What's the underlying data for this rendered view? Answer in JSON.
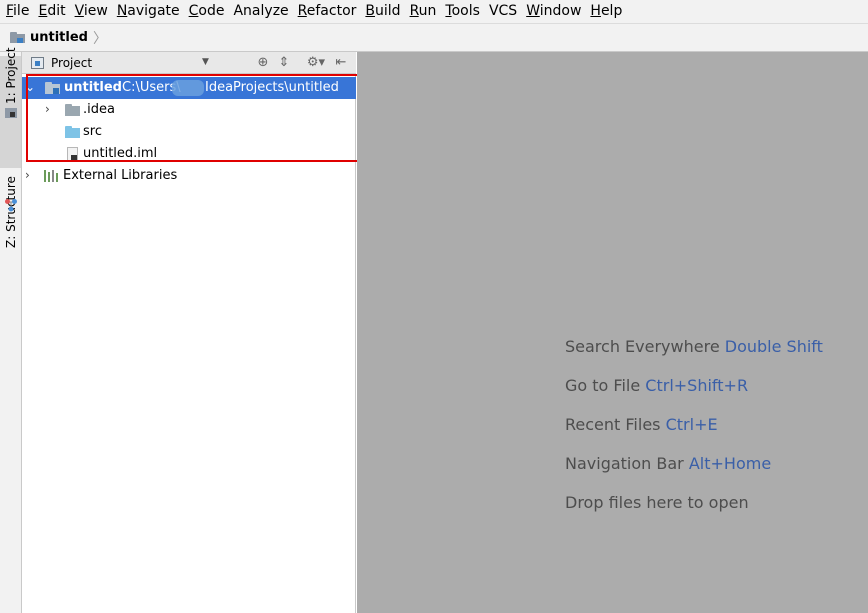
{
  "menubar": {
    "items": [
      {
        "mnemonic": "F",
        "rest": "ile"
      },
      {
        "mnemonic": "E",
        "rest": "dit"
      },
      {
        "mnemonic": "V",
        "rest": "iew"
      },
      {
        "mnemonic": "N",
        "rest": "avigate"
      },
      {
        "mnemonic": "C",
        "rest": "ode"
      },
      {
        "mnemonic": "",
        "rest": "Analyze"
      },
      {
        "mnemonic": "R",
        "rest": "efactor"
      },
      {
        "mnemonic": "B",
        "rest": "uild"
      },
      {
        "mnemonic": "R",
        "rest": "un"
      },
      {
        "mnemonic": "T",
        "rest": "ools"
      },
      {
        "mnemonic": "",
        "rest": "VCS"
      },
      {
        "mnemonic": "W",
        "rest": "indow"
      },
      {
        "mnemonic": "H",
        "rest": "elp"
      }
    ]
  },
  "breadcrumb": {
    "project": "untitled",
    "separator": "〉"
  },
  "left_strip": {
    "project_tab": "1: Project",
    "structure_tab": "Z: Structure"
  },
  "project_panel": {
    "header_title": "Project",
    "dropdown_glyph": "▼",
    "buttons": {
      "locate": "⊕",
      "collapse": "⇕",
      "settings": "⚙▾",
      "hide": "⇤"
    },
    "tree": {
      "root": {
        "name": "untitled",
        "path_prefix": "C:\\Users\\",
        "path_suffix": "IdeaProjects\\untitled",
        "chevron": "⌄"
      },
      "children": [
        {
          "name": ".idea",
          "chevron": "›"
        },
        {
          "name": "src"
        },
        {
          "name": "untitled.iml"
        }
      ],
      "external": {
        "name": "External Libraries",
        "chevron": "›"
      }
    }
  },
  "editor": {
    "hints": [
      {
        "text": "Search Everywhere",
        "key": "Double Shift"
      },
      {
        "text": "Go to File",
        "key": "Ctrl+Shift+R"
      },
      {
        "text": "Recent Files",
        "key": "Ctrl+E"
      },
      {
        "text": "Navigation Bar",
        "key": "Alt+Home"
      },
      {
        "text": "Drop files here to open",
        "key": ""
      }
    ]
  },
  "colors": {
    "selection": "#3875d7",
    "highlight_border": "#e00000",
    "editor_bg": "#acacac",
    "shortcut_text": "#3a5fa8"
  }
}
